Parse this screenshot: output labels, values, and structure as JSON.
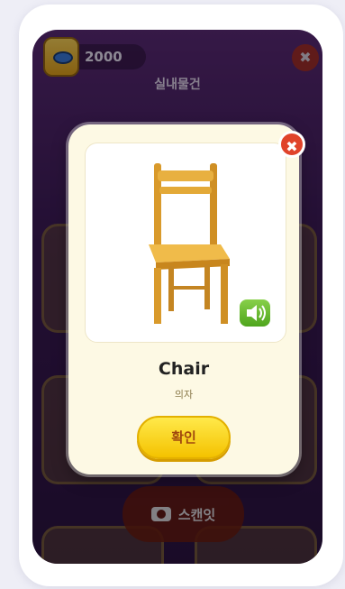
{
  "topbar": {
    "coins": "2000",
    "close_label": "✖"
  },
  "category": {
    "title": "실내물건"
  },
  "scan": {
    "label": "스캔잇"
  },
  "modal": {
    "close_label": "✖",
    "word": "Chair",
    "translation": "의자",
    "confirm_label": "확인"
  },
  "icons": {
    "coin": "coin-icon",
    "camera": "camera-icon",
    "speaker": "speaker-icon",
    "close": "close-icon"
  },
  "colors": {
    "accent": "#f4c200",
    "sound_green": "#6cbf32",
    "close_red": "#e0432a"
  }
}
